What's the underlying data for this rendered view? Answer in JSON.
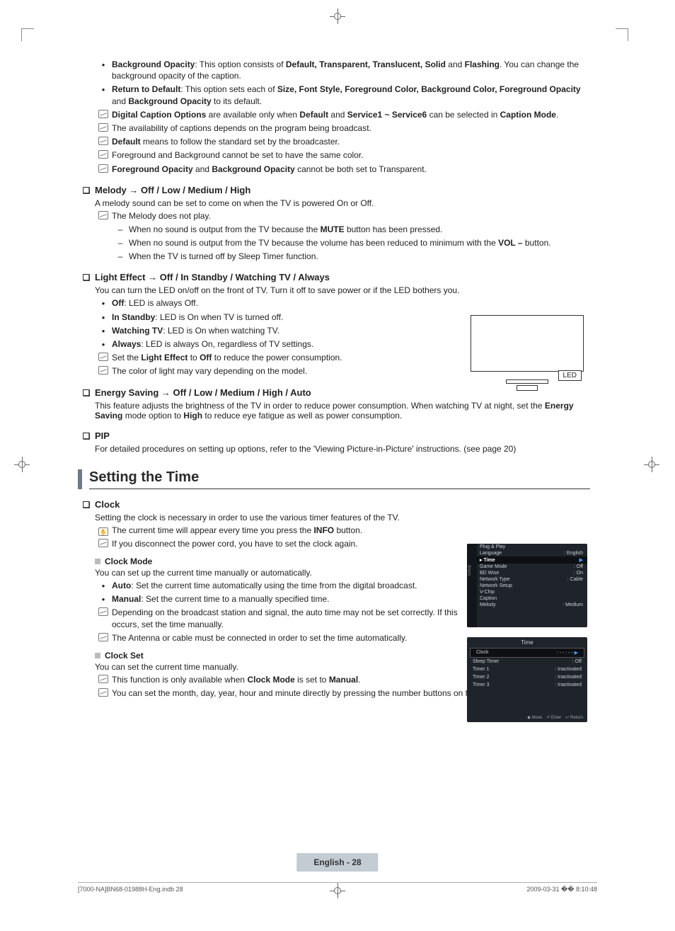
{
  "bullets_top": [
    {
      "lead": "Background Opacity",
      "rest": ": This option consists of ",
      "b2": "Default, Transparent, Translucent, Solid",
      "mid": " and ",
      "b3": "Flashing",
      "tail": ". You can change the background opacity of the caption."
    },
    {
      "lead": "Return to Default",
      "rest": ": This option sets each of ",
      "b2": "Size, Font Style, Foreground Color, Background Color, Foreground Opacity",
      "mid": " and ",
      "b3": "Background Opacity",
      "tail": " to its default."
    }
  ],
  "notes_top": [
    {
      "html": "<b>Digital Caption Options</b> are available only when <b>Default</b> and <b>Service1 ~ Service6</b> can be selected in <b>Caption Mode</b>."
    },
    {
      "html": "The availability of captions depends on the program being broadcast."
    },
    {
      "html": "<b>Default</b> means to follow the standard set by the broadcaster."
    },
    {
      "html": "Foreground and Background cannot be set to have the same color."
    },
    {
      "html": "<b>Foreground Opacity</b> and <b>Background Opacity</b> cannot be both set to Transparent."
    }
  ],
  "melody_h": "Melody → Off / Low / Medium / High",
  "melody_p": "A melody sound can be set to come on when the TV is powered On or Off.",
  "melody_note": "The Melody does not play.",
  "melody_dash": [
    "When no sound is output from the TV because the <b>MUTE</b> button has been pressed.",
    "When no sound is output from the TV because the volume has been reduced to minimum with the <b>VOL –</b> button.",
    "When the TV is turned off by Sleep Timer function."
  ],
  "light_h": "Light Effect → Off / In Standby / Watching TV / Always",
  "light_p": "You can turn the LED on/off on the front of TV. Turn it off to save power or if the LED bothers you.",
  "light_b": [
    {
      "b": "Off",
      "t": ": LED is always Off."
    },
    {
      "b": "In Standby",
      "t": ": LED is On when TV is turned off."
    },
    {
      "b": "Watching TV",
      "t": ": LED is On when watching TV."
    },
    {
      "b": "Always",
      "t": ": LED is always On, regardless of TV settings."
    }
  ],
  "light_note": [
    "Set the <b>Light Effect</b> to <b>Off</b> to reduce the power consumption.",
    "The color of light may vary depending on the model."
  ],
  "led_label": "LED",
  "energy_h": "Energy Saving → Off / Low / Medium / High / Auto",
  "energy_p": "This feature adjusts the brightness of the TV in order to reduce power consumption. When watching TV at night, set the <b>Energy Saving</b> mode option to <b>High</b> to reduce eye fatigue as well as power consumption.",
  "pip_h": "PIP",
  "pip_p": "For detailed procedures on setting up options, refer to the 'Viewing Picture-in-Picture' instructions. (see page 20)",
  "section": "Setting the Time",
  "clock_h": "Clock",
  "clock_p": "Setting the clock is necessary in order to use the various timer features of the TV.",
  "clock_hand": "The current time will appear every time you press the <b>INFO</b> button.",
  "clock_note": "If you disconnect the power cord, you have to set the clock again.",
  "cmode_h": "Clock Mode",
  "cmode_p": "You can set up the current time manually or automatically.",
  "cmode_b": [
    {
      "b": "Auto",
      "t": ": Set the current time automatically using the time from the digital broadcast."
    },
    {
      "b": "Manual",
      "t": ": Set the current time to a manually specified time."
    }
  ],
  "cmode_note": [
    "Depending on the broadcast station and signal, the auto time may not be set correctly. If this occurs, set the time manually.",
    "The Antenna or cable must be connected in order to set the time automatically."
  ],
  "cset_h": "Clock Set",
  "cset_p": "You can set the current time manually.",
  "cset_note": [
    "This function is only available when <b>Clock Mode</b> is set to <b>Manual</b>.",
    "You can set the month, day, year, hour and minute directly by pressing the number buttons on the remote control."
  ],
  "osd1": {
    "vtxt": "Setup",
    "rows": [
      {
        "l": "Plug & Play",
        "r": ""
      },
      {
        "l": "Language",
        "r": ": English"
      },
      {
        "l": "Time",
        "r": "",
        "hi": true,
        "arrow": true
      },
      {
        "l": "Game Mode",
        "r": ": Off"
      },
      {
        "l": "BD Wise",
        "r": ": On"
      },
      {
        "l": "Network Type",
        "r": ": Cable"
      },
      {
        "l": "Network Setup",
        "r": ""
      },
      {
        "l": "V-Chip",
        "r": ""
      },
      {
        "l": "Caption",
        "r": ""
      },
      {
        "l": "Melody",
        "r": ": Medium"
      }
    ]
  },
  "osd2": {
    "title": "Time",
    "rows": [
      {
        "l": "Clock",
        "r": ": - - : - -",
        "hi": true,
        "arrow": true
      },
      {
        "l": "Sleep Timer",
        "r": ": Off"
      },
      {
        "l": "Timer 1",
        "r": ": Inactivated"
      },
      {
        "l": "Timer 2",
        "r": ": Inactivated"
      },
      {
        "l": "Timer 3",
        "r": ": Inactivated"
      }
    ],
    "foot": [
      "◆ Move",
      "⏎ Enter",
      "↩ Return"
    ]
  },
  "pagefoot": "English - 28",
  "printfoot_l": "[7000-NA]BN68-01988H-Eng.indb   28",
  "printfoot_r": "2009-03-31   �� 8:10:48"
}
